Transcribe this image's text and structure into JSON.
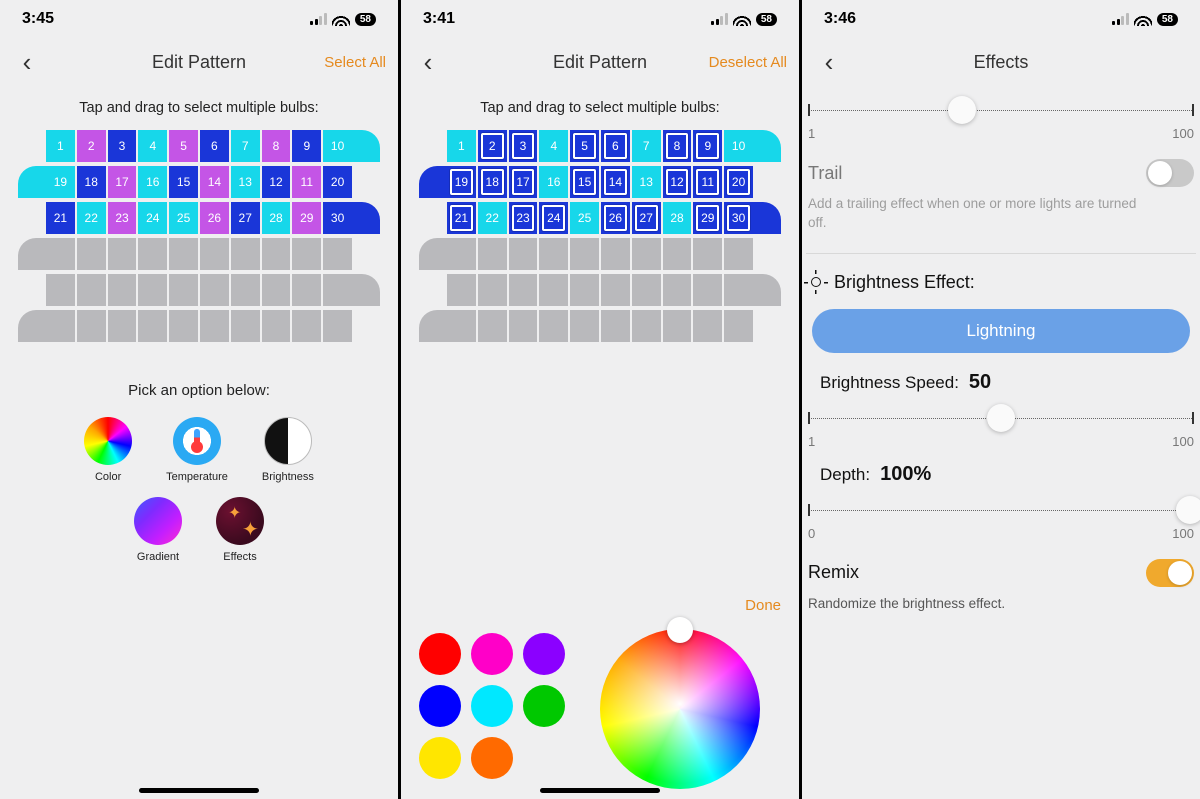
{
  "status_time": {
    "s1": "3:45",
    "s2": "3:41",
    "s3": "3:46"
  },
  "status_battery": "58",
  "screen1": {
    "title": "Edit Pattern",
    "action": "Select All",
    "instruction": "Tap and drag to select multiple bulbs:",
    "bulbs": [
      {
        "n": 1,
        "c": "#17d7ea"
      },
      {
        "n": 2,
        "c": "#c455e6"
      },
      {
        "n": 3,
        "c": "#1a36d8"
      },
      {
        "n": 4,
        "c": "#17d7ea"
      },
      {
        "n": 5,
        "c": "#c455e6"
      },
      {
        "n": 6,
        "c": "#1a36d8"
      },
      {
        "n": 7,
        "c": "#17d7ea"
      },
      {
        "n": 8,
        "c": "#c455e6"
      },
      {
        "n": 9,
        "c": "#1a36d8"
      },
      {
        "n": 10,
        "c": "#17d7ea"
      },
      {
        "n": 19,
        "c": "#17d7ea"
      },
      {
        "n": 18,
        "c": "#1a36d8"
      },
      {
        "n": 17,
        "c": "#c455e6"
      },
      {
        "n": 16,
        "c": "#17d7ea"
      },
      {
        "n": 15,
        "c": "#1a36d8"
      },
      {
        "n": 14,
        "c": "#c455e6"
      },
      {
        "n": 13,
        "c": "#17d7ea"
      },
      {
        "n": 12,
        "c": "#1a36d8"
      },
      {
        "n": 11,
        "c": "#c455e6"
      },
      {
        "n": 20,
        "c": "#1a36d8"
      },
      {
        "n": 21,
        "c": "#1a36d8"
      },
      {
        "n": 22,
        "c": "#17d7ea"
      },
      {
        "n": 23,
        "c": "#c455e6"
      },
      {
        "n": 24,
        "c": "#17d7ea"
      },
      {
        "n": 25,
        "c": "#17d7ea"
      },
      {
        "n": 26,
        "c": "#c455e6"
      },
      {
        "n": 27,
        "c": "#1a36d8"
      },
      {
        "n": 28,
        "c": "#17d7ea"
      },
      {
        "n": 29,
        "c": "#c455e6"
      },
      {
        "n": 30,
        "c": "#1a36d8"
      }
    ],
    "pick_label": "Pick an option below:",
    "options": [
      "Color",
      "Temperature",
      "Brightness",
      "Gradient",
      "Effects"
    ]
  },
  "screen2": {
    "title": "Edit Pattern",
    "action": "Deselect All",
    "instruction": "Tap and drag to select multiple bulbs:",
    "bulbs": [
      {
        "n": 1,
        "c": "#17d7ea",
        "sel": false
      },
      {
        "n": 2,
        "c": "#1a36d8",
        "sel": true
      },
      {
        "n": 3,
        "c": "#1a36d8",
        "sel": true
      },
      {
        "n": 4,
        "c": "#17d7ea",
        "sel": false
      },
      {
        "n": 5,
        "c": "#1a36d8",
        "sel": true
      },
      {
        "n": 6,
        "c": "#1a36d8",
        "sel": true
      },
      {
        "n": 7,
        "c": "#17d7ea",
        "sel": false
      },
      {
        "n": 8,
        "c": "#1a36d8",
        "sel": true
      },
      {
        "n": 9,
        "c": "#1a36d8",
        "sel": true
      },
      {
        "n": 10,
        "c": "#17d7ea",
        "sel": false
      },
      {
        "n": 19,
        "c": "#1a36d8",
        "sel": true
      },
      {
        "n": 18,
        "c": "#1a36d8",
        "sel": true
      },
      {
        "n": 17,
        "c": "#1a36d8",
        "sel": true
      },
      {
        "n": 16,
        "c": "#17d7ea",
        "sel": false
      },
      {
        "n": 15,
        "c": "#1a36d8",
        "sel": true
      },
      {
        "n": 14,
        "c": "#1a36d8",
        "sel": true
      },
      {
        "n": 13,
        "c": "#17d7ea",
        "sel": false
      },
      {
        "n": 12,
        "c": "#1a36d8",
        "sel": true
      },
      {
        "n": 11,
        "c": "#1a36d8",
        "sel": true
      },
      {
        "n": 20,
        "c": "#1a36d8",
        "sel": true
      },
      {
        "n": 21,
        "c": "#1a36d8",
        "sel": true
      },
      {
        "n": 22,
        "c": "#17d7ea",
        "sel": false
      },
      {
        "n": 23,
        "c": "#1a36d8",
        "sel": true
      },
      {
        "n": 24,
        "c": "#1a36d8",
        "sel": true
      },
      {
        "n": 25,
        "c": "#17d7ea",
        "sel": false
      },
      {
        "n": 26,
        "c": "#1a36d8",
        "sel": true
      },
      {
        "n": 27,
        "c": "#1a36d8",
        "sel": true
      },
      {
        "n": 28,
        "c": "#17d7ea",
        "sel": false
      },
      {
        "n": 29,
        "c": "#1a36d8",
        "sel": true
      },
      {
        "n": 30,
        "c": "#1a36d8",
        "sel": true
      }
    ],
    "done": "Done",
    "swatches": [
      "#ff0000",
      "#ff00c8",
      "#8b00ff",
      "#0000ff",
      "#00e8ff",
      "#00c800",
      "#ffe600",
      "#ff6a00"
    ]
  },
  "screen3": {
    "title": "Effects",
    "slider_top": {
      "min": "1",
      "max": "100",
      "pos": 40
    },
    "trail": {
      "label": "Trail",
      "desc": "Add a trailing effect when one or more lights are turned off.",
      "on": false
    },
    "section_title": "Brightness Effect:",
    "pill": "Lightning",
    "speed": {
      "label": "Brightness Speed:",
      "value": "50",
      "min": "1",
      "max": "100",
      "pos": 50
    },
    "depth": {
      "label": "Depth:",
      "value": "100%",
      "min": "0",
      "max": "100",
      "pos": 100
    },
    "remix": {
      "label": "Remix",
      "desc": "Randomize the brightness effect.",
      "on": true
    }
  }
}
